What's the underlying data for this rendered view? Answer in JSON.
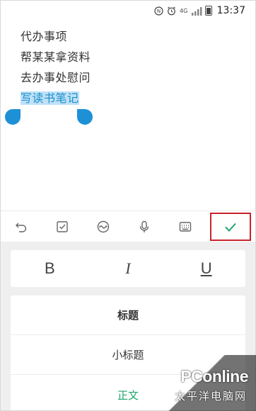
{
  "status_bar": {
    "time": "13:37",
    "icons": [
      "nfc-icon",
      "alarm-icon",
      "hd-icon",
      "signal-icon",
      "battery-icon"
    ],
    "hd_label": "4G"
  },
  "note": {
    "lines": [
      "代办事项",
      "帮某某拿资料",
      "去办事处慰问",
      "写读书笔记"
    ],
    "selected_index": 3
  },
  "toolbar": {
    "tools": [
      "undo-icon",
      "checklist-icon",
      "drawing-icon",
      "microphone-icon",
      "keyboard-icon",
      "confirm-check-icon"
    ],
    "accent": "#1fa66a",
    "highlight_border": "#c9242b"
  },
  "format": {
    "bold": "B",
    "italic": "I",
    "underline": "U",
    "headings": [
      "标题",
      "小标题",
      "正文"
    ],
    "active_heading": "正文"
  },
  "watermark": {
    "logo": "PConline",
    "sub": "太平洋电脑网"
  },
  "colors": {
    "selection_bg": "#bfe1f7",
    "selection_text": "#1a8fce",
    "handle": "#1e90d6",
    "panel_bg": "#efefef"
  }
}
